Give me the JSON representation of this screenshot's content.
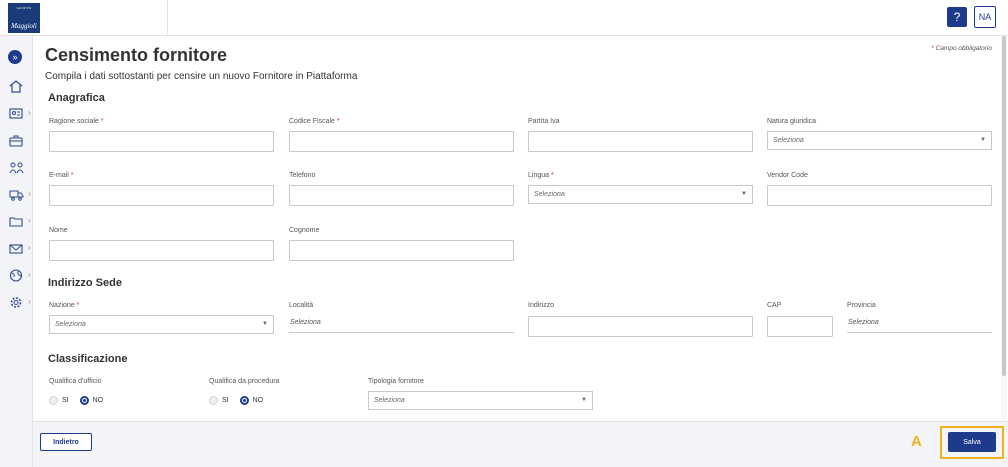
{
  "app": {
    "logo_small": "GRUPPO",
    "logo_big": "Maggioli",
    "help_label": "?",
    "user_initials": "NA"
  },
  "sidebar": {
    "toggle_icon": "»",
    "items": [
      {
        "icon": "home-icon"
      },
      {
        "icon": "id-card-icon"
      },
      {
        "icon": "briefcase-icon"
      },
      {
        "icon": "users-icon"
      },
      {
        "icon": "truck-icon"
      },
      {
        "icon": "folder-icon"
      },
      {
        "icon": "mail-icon"
      },
      {
        "icon": "globe-icon"
      },
      {
        "icon": "gear-icon"
      }
    ]
  },
  "page": {
    "title": "Censimento fornitore",
    "subtitle": "Compila i dati sottostanti per censire un nuovo Fornitore in Piattaforma",
    "required_note": "Campo obbligatorio",
    "required_star": "*"
  },
  "anagrafica": {
    "title": "Anagrafica",
    "ragione_sociale": "Ragione sociale",
    "codice_fiscale": "Codice Fiscale",
    "partita_iva": "Partita Iva",
    "natura_giuridica": "Natura giuridica",
    "natura_placeholder": "Seleziona",
    "email": "E-mail",
    "telefono": "Telefono",
    "lingua": "Lingua",
    "lingua_placeholder": "Seleziona",
    "vendor_code": "Vendor Code",
    "nome": "Nome",
    "cognome": "Cognome"
  },
  "indirizzo": {
    "title": "Indirizzo Sede",
    "nazione": "Nazione",
    "nazione_placeholder": "Seleziona",
    "localita": "Località",
    "localita_value": "Seleziona",
    "indirizzo": "Indirizzo",
    "cap": "CAP",
    "provincia": "Provincia",
    "provincia_value": "Seleziona"
  },
  "classificazione": {
    "title": "Classificazione",
    "qualifica_ufficio": "Qualifica d'ufficio",
    "qualifica_procedura": "Qualifica da procedura",
    "tipologia": "Tipologia fornitore",
    "tipologia_placeholder": "Seleziona",
    "opt_si": "SI",
    "opt_no": "NO"
  },
  "footer": {
    "back_label": "Indietro",
    "save_label": "Salva",
    "annotation": "A"
  },
  "colors": {
    "primary": "#1e3a8a",
    "required": "#c0392b",
    "highlight": "#f2b01e"
  }
}
